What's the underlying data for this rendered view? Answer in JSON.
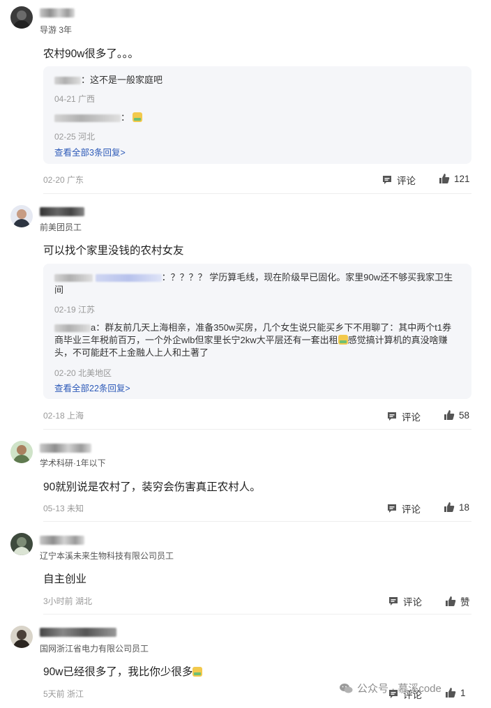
{
  "comments": [
    {
      "sub": "导游 3年",
      "content": "农村90w很多了。。。",
      "replies": [
        {
          "text": "：这不是一般家庭吧",
          "meta": "04-21 广西"
        },
        {
          "text": "：",
          "meta": "02-25 河北"
        }
      ],
      "view_all": "查看全部3条回复>",
      "meta": "02-20 广东",
      "comment_label": "评论",
      "likes": "121"
    },
    {
      "sub": "前美团员工",
      "content": "可以找个家里没钱的农村女友",
      "replies": [
        {
          "text": "：？？？？ 学历算毛线，现在阶级早已固化。家里90w还不够买我家卫生间",
          "meta": "02-19 江苏"
        },
        {
          "text": "a：群友前几天上海相亲，准备350w买房，几个女生说只能买乡下不用聊了：其中两个t1券商毕业三年税前百万，一个外企wlb但家里长宁2kw大平层还有一套出租",
          "text2": "感觉搞计算机的真没啥赚头，不可能赶不上金融人上人和土著了",
          "meta": "02-20 北美地区"
        }
      ],
      "view_all": "查看全部22条回复>",
      "meta": "02-18 上海",
      "comment_label": "评论",
      "likes": "58"
    },
    {
      "sub": "学术科研·1年以下",
      "content": "90就别说是农村了，装穷会伤害真正农村人。",
      "meta": "05-13 未知",
      "comment_label": "评论",
      "likes": "18"
    },
    {
      "sub": "辽宁本溪未来生物科技有限公司员工",
      "content": "自主创业",
      "meta": "3小时前 湖北",
      "comment_label": "评论",
      "likes": "赞"
    },
    {
      "sub": "国网浙江省电力有限公司员工",
      "content": "90w已经很多了，我比你少很多",
      "meta": "5天前 浙江",
      "comment_label": "评论",
      "likes": "1"
    }
  ],
  "watermark": "公众号 · 慕溪code",
  "colors": {
    "link": "#2d5ab8",
    "meta": "#999999",
    "reply_bg": "#f5f6f9"
  }
}
